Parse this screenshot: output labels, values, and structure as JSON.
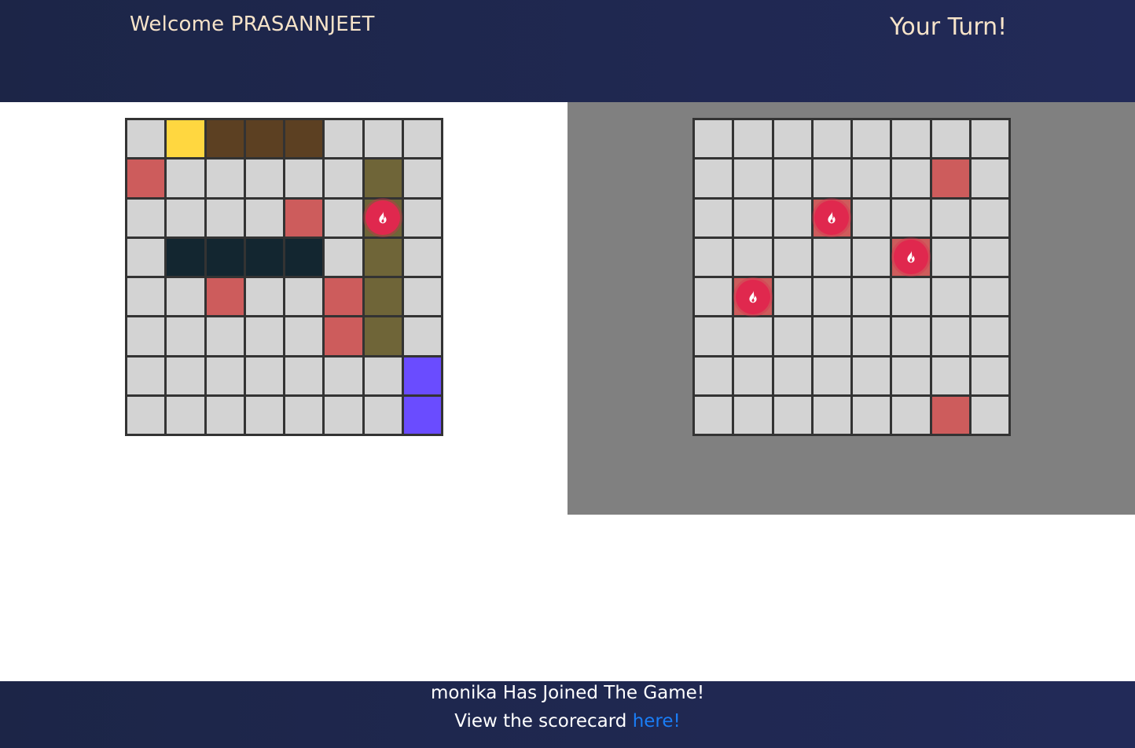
{
  "header": {
    "welcome_text": "Welcome PRASANNJEET",
    "turn_text": "Your Turn!"
  },
  "colors": {
    "empty": "#d3d3d3",
    "miss": "#cd5c5c",
    "ship_yellow": "#ffd740",
    "ship_brown": "#5c4022",
    "ship_olive": "#6f6538",
    "ship_navy": "#132630",
    "ship_violet": "#6a4cff",
    "hit": "#e0284e",
    "enemy_panel_bg": "#808080",
    "header_bg": "#1f2750",
    "link": "#1a7df5"
  },
  "legend": {
    "E": "empty",
    "M": "miss",
    "Y": "ship_yellow",
    "B": "ship_brown",
    "O": "ship_olive",
    "N": "ship_navy",
    "V": "ship_violet",
    "H": "hit"
  },
  "player_board": {
    "rows": [
      [
        "E",
        "Y",
        "B",
        "B",
        "B",
        "E",
        "E",
        "E"
      ],
      [
        "M",
        "E",
        "E",
        "E",
        "E",
        "E",
        "O",
        "E"
      ],
      [
        "E",
        "E",
        "E",
        "E",
        "M",
        "E",
        "H",
        "E"
      ],
      [
        "E",
        "N",
        "N",
        "N",
        "N",
        "E",
        "O",
        "E"
      ],
      [
        "E",
        "E",
        "M",
        "E",
        "E",
        "M",
        "O",
        "E"
      ],
      [
        "E",
        "E",
        "E",
        "E",
        "E",
        "M",
        "O",
        "E"
      ],
      [
        "E",
        "E",
        "E",
        "E",
        "E",
        "E",
        "E",
        "V"
      ],
      [
        "E",
        "E",
        "E",
        "E",
        "E",
        "E",
        "E",
        "V"
      ]
    ],
    "hit_underlay": {
      "2,6": "ship_olive"
    }
  },
  "enemy_board": {
    "rows": [
      [
        "E",
        "E",
        "E",
        "E",
        "E",
        "E",
        "E",
        "E"
      ],
      [
        "E",
        "E",
        "E",
        "E",
        "E",
        "E",
        "M",
        "E"
      ],
      [
        "E",
        "E",
        "E",
        "H",
        "E",
        "E",
        "E",
        "E"
      ],
      [
        "E",
        "E",
        "E",
        "E",
        "E",
        "H",
        "E",
        "E"
      ],
      [
        "E",
        "H",
        "E",
        "E",
        "E",
        "E",
        "E",
        "E"
      ],
      [
        "E",
        "E",
        "E",
        "E",
        "E",
        "E",
        "E",
        "E"
      ],
      [
        "E",
        "E",
        "E",
        "E",
        "E",
        "E",
        "E",
        "E"
      ],
      [
        "E",
        "E",
        "E",
        "E",
        "E",
        "E",
        "M",
        "E"
      ]
    ],
    "hit_underlay": {
      "2,3": "miss",
      "3,5": "miss",
      "4,1": "miss"
    }
  },
  "footer": {
    "join_message": "monika Has Joined The Game!",
    "scorecard_prefix": "View the scorecard ",
    "scorecard_link": "here!"
  },
  "icons": {
    "hit_marker": "fire-icon"
  }
}
